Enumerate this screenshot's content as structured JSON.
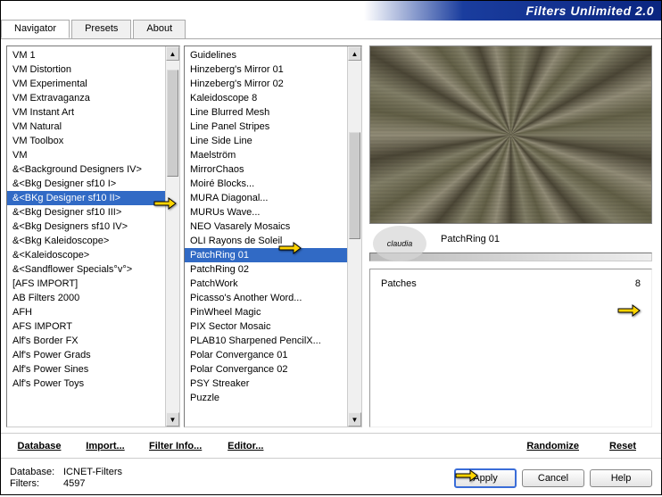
{
  "app": {
    "title": "Filters Unlimited 2.0"
  },
  "tabs": [
    {
      "label": "Navigator",
      "active": true
    },
    {
      "label": "Presets",
      "active": false
    },
    {
      "label": "About",
      "active": false
    }
  ],
  "categories": {
    "items": [
      "VM 1",
      "VM Distortion",
      "VM Experimental",
      "VM Extravaganza",
      "VM Instant Art",
      "VM Natural",
      "VM Toolbox",
      "VM",
      "&<Background Designers IV>",
      "&<Bkg Designer sf10 I>",
      "&<BKg Designer sf10 II>",
      "&<Bkg Designer sf10 III>",
      "&<Bkg Designers sf10 IV>",
      "&<Bkg Kaleidoscope>",
      "&<Kaleidoscope>",
      "&<Sandflower Specials°v°>",
      "[AFS IMPORT]",
      "AB Filters 2000",
      "AFH",
      "AFS IMPORT",
      "Alf's Border FX",
      "Alf's Power Grads",
      "Alf's Power Sines",
      "Alf's Power Toys"
    ],
    "selected_index": 10
  },
  "filters": {
    "items": [
      "Guidelines",
      "Hinzeberg's Mirror 01",
      "Hinzeberg's Mirror 02",
      "Kaleidoscope 8",
      "Line Blurred Mesh",
      "Line Panel Stripes",
      "Line Side Line",
      "Maelström",
      "MirrorChaos",
      "Moiré Blocks...",
      "MURA Diagonal...",
      "MURUs Wave...",
      "NEO Vasarely Mosaics",
      "OLI Rayons de Soleil",
      "PatchRing 01",
      "PatchRing 02",
      "PatchWork",
      "Picasso's Another Word...",
      "PinWheel Magic",
      "PIX Sector Mosaic",
      "PLAB10 Sharpened PencilX...",
      "Polar Convergance 01",
      "Polar Convergance 02",
      "PSY Streaker",
      "Puzzle"
    ],
    "selected_index": 14
  },
  "preview": {
    "filter_name": "PatchRing 01",
    "stamp_text": "claudia",
    "params": [
      {
        "label": "Patches",
        "value": "8"
      }
    ]
  },
  "toolbar": {
    "database": "Database",
    "import": "Import...",
    "filter_info": "Filter Info...",
    "editor": "Editor...",
    "randomize": "Randomize",
    "reset": "Reset"
  },
  "status": {
    "db_label": "Database:",
    "db_value": "ICNET-Filters",
    "filters_label": "Filters:",
    "filters_value": "4597"
  },
  "buttons": {
    "apply": "Apply",
    "cancel": "Cancel",
    "help": "Help"
  }
}
